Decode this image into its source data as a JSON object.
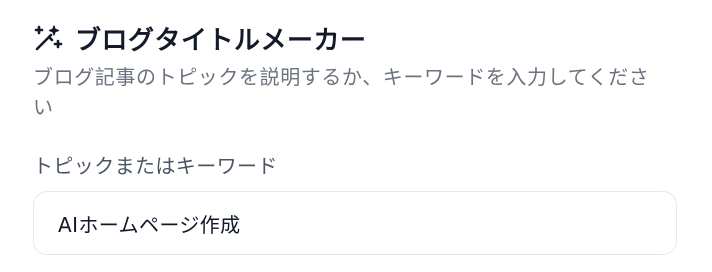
{
  "header": {
    "icon": "magic-wand-icon",
    "title": "ブログタイトルメーカー"
  },
  "description": "ブログ記事のトピックを説明するか、キーワードを入力してください",
  "form": {
    "topic_label": "トピックまたはキーワード",
    "topic_value": "AIホームページ作成"
  }
}
